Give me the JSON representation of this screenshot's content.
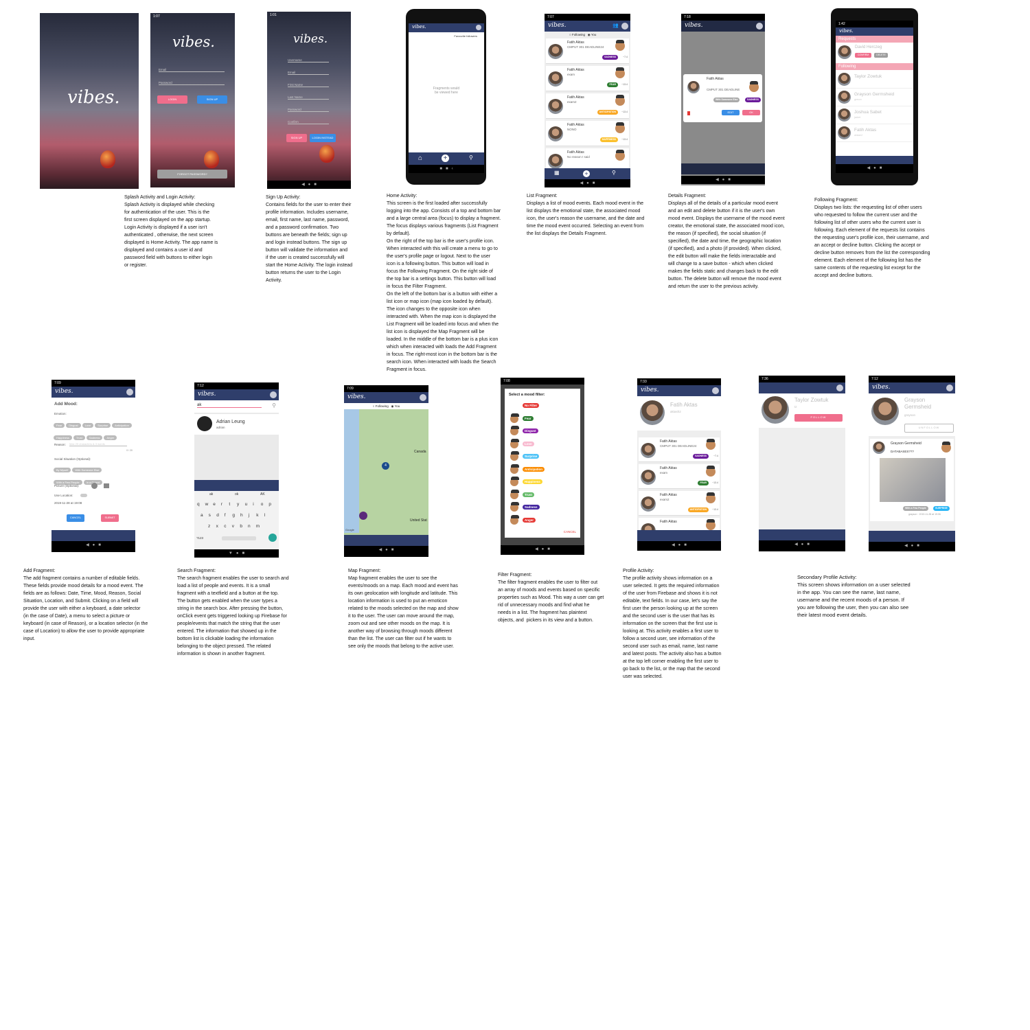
{
  "app": {
    "logo": "vibes."
  },
  "splash": {
    "caption": "Splash Activity and Login Activity:\nSplash Activity is displayed while checking\nfor authentication of the user. This is the\nfirst screen displayed on the app startup.\nLogin Activity is displayed if a user isn't\nauthenticated , otherwise, the next screen\ndisplayed is Home Activity. The app name is\ndisplayed and contains a user id and\npassword field with buttons to either login\nor register."
  },
  "login": {
    "email": "Email",
    "password": "Password",
    "login": "LOGIN",
    "signup": "SIGN UP",
    "forgot": "FORGOT PASSWORD?"
  },
  "signup": {
    "fields": [
      "Username",
      "Email",
      "First Name",
      "Last Name",
      "Password",
      "Confirm"
    ],
    "signup": "SIGN UP",
    "login_instead": "LOGIN INSTEAD",
    "caption": "Sign Up Activity:\nContains fields for the user to enter their\nprofile information. Includes username,\nemail, first name, last name, password,\nand a password confirmation. Two\nbuttons are beneath the fields; sign up\nand login instead buttons. The sign up\nbutton will validate the information and\nif the user is created successfully will\nstart the Home Activity. The login instead\nbutton returns the user to the Login\nActivity."
  },
  "home": {
    "right_link": "Favourite followers",
    "placeholder": "Fragments would\nbe viewed here",
    "caption": "Home Activity:\nThis screen is the first loaded after successfully\nlogging into the app. Consists of a top and bottom bar\nand a large central area (focus) to display a fragment.\nThe focus displays various fragments (List Fragment\nby default).\nOn the right of the top bar is the user's profile icon.\nWhen interacted with this will create a menu to go to\nthe user's profile page or logout. Next to the user\nicon is a following button. This button will load in\nfocus the Following Fragment. On the right side of\nthe top bar is a settings button. This button will load\nin focus the Filter Fragment.\nOn the left of the bottom bar is a button with either a\nlist icon or map icon (map icon loaded by default).\nThe icon changes to the opposite icon when\ninteracted with. When the map icon is displayed the\nList Fragment will be loaded into focus and when the\nlist icon is displayed the Map Fragment will be\nloaded. In the middle of the bottom bar is a plus icon\nwhich when interacted with loads the Add Fragment\nin focus. The right-most icon in the bottom bar is the\nsearch icon. When interacted with loads the Search\nFragment in focus."
  },
  "list": {
    "toggle_following": "Following",
    "toggle_you": "You",
    "items": [
      {
        "name": "Fatih Aktas",
        "reason": "CMPUT 301 DEADLINE24",
        "tag": "SADNESS",
        "tag_color": "#6a1b9a",
        "time": "~7.4"
      },
      {
        "name": "Fatih Aktas",
        "reason": "exam",
        "tag": "FEAR",
        "tag_color": "#2e7d32",
        "time": "~13.4"
      },
      {
        "name": "Fatih Aktas",
        "reason": "exam2",
        "tag": "ANTICIPATION",
        "tag_color": "#f9a825",
        "time": "~13.4"
      },
      {
        "name": "Fatih Aktas",
        "reason": "NONO",
        "tag": "HAPPINESS",
        "tag_color": "#fbc02d",
        "time": "~13.4"
      },
      {
        "name": "Fatih Aktas",
        "reason": "No reason I said",
        "tag": "",
        "tag_color": "#000000",
        "time": ""
      }
    ],
    "caption": "List Fragment:\nDisplays a list of mood events. Each mood event in the\nlist displays the emotional state, the associated mood\nicon, the user's reason the username, and the date and\ntime the mood event occurred. Selecting an event from\nthe list displays the Details Fragment."
  },
  "details": {
    "name": "Fatih Aktas",
    "reason": "CMPUT 301 DEADLINE",
    "situation": "With Someone Else",
    "tag": "SADNESS",
    "edit": "EDIT",
    "ok": "OK",
    "caption": "Details Fragment:\nDisplays all of the details of a particular mood event\nand an edit and delete button if it is the user's own\nmood event. Displays the username of the mood event\ncreator, the emotional state, the associated mood icon,\nthe reason (if specified), the social situation (if\nspecified), the date and time, the geographic location\n(if specified), and a photo (if provided). When clicked,\nthe edit button will make the fields interactable and\nwill change to a save button - which when clicked\nmakes the fields static and changes back to the edit\nbutton. The delete button will remove the mood event\nand return the user to the previous activity."
  },
  "following": {
    "requests_header": "Requests",
    "following_header": "Following",
    "requests": [
      {
        "name": "David Herczeg",
        "accept": "CONFIRM",
        "decline": "DELETE"
      }
    ],
    "list": [
      {
        "name": "Taylor Zowtuk",
        "user": ""
      },
      {
        "name": "Grayson Germsheid",
        "user": "gerson"
      },
      {
        "name": "Joshua Sabet",
        "user": "jsabet"
      },
      {
        "name": "Fatih Aktas",
        "user": "aktash2"
      }
    ],
    "caption": "Following Fragment:\nDisplays two lists: the requesting list of other users\nwho requested to follow the current user and the\nfollowing list of other users who the current user is\nfollowing. Each element of the requests list contains\nthe requesting user's profile icon, their username, and\nan accept or decline button. Clicking the accept or\ndecline button removes from the list the corresponding\nelement. Each element of the following list has the\nsame contents of the requesting list except for the\naccept and decline buttons."
  },
  "add": {
    "title": "Add Mood:",
    "emotion": "Emotion:",
    "emotions": [
      "Fear",
      "Disgust",
      "Love",
      "Surprise",
      "Anticipation",
      "Happiness",
      "Trust",
      "Sadness",
      "Anger"
    ],
    "reason": "Reason:",
    "reason_ph": "Max 20 characters & 3 words",
    "counter": "0 / 20",
    "social": "Social Situation (Optional):",
    "socials": [
      "By Myself",
      "With Someone Else",
      "With a Few People",
      "In a Crowd"
    ],
    "picture": "Picture (Optional):",
    "location": "Use Location:",
    "date": "2019-11-28 at 19:08",
    "cancel": "CANCEL",
    "submit": "SUBMIT",
    "caption": "Add Fragment:\nThe add fragment contains a number of editable fields.\nThese fields provide mood details for a mood event. The\nfields are as follows: Date, Time, Mood, Reason, Social\nSituation, Location, and Submit. Clicking on a field will\nprovide the user with either a keyboard, a date selector\n(in the case of Date), a menu to select a picture or\nkeyboard (in case of Reason), or a location selector (in the\ncase of Location) to allow the user to provide appropriate\ninput."
  },
  "search": {
    "query": "ak",
    "result_name": "Adrian Leung",
    "result_user": "adrian",
    "suggestions": [
      "ak",
      "ok",
      "AK"
    ],
    "keys_row1": [
      "q",
      "w",
      "e",
      "r",
      "t",
      "y",
      "u",
      "i",
      "o",
      "p"
    ],
    "keys_row2": [
      "a",
      "s",
      "d",
      "f",
      "g",
      "h",
      "j",
      "k",
      "l"
    ],
    "keys_row3": [
      "z",
      "x",
      "c",
      "v",
      "b",
      "n",
      "m"
    ],
    "key_num": "?123",
    "caption": "Search Fragment:\nThe search fragment enables the user to search and\nload a list of people and events. It is a small\nfragment with a textfield and a button at the top.\nThe button gets enabled when the user types a\nstring in the search box. After pressing the button,\nonClick event gets triggered looking up Firebase for\npeople/events that match the string that the user\nentered. The information that showed up in the\nbottom list is clickable loading the information\nbelonging to the object pressed. The related\ninformation is shown in another fragment."
  },
  "map": {
    "canada": "Canada",
    "us": "United Stat",
    "cluster": "4",
    "google": "Google",
    "caption": "Map Fragment:\nMap fragment enables the user to see the\nevents/moods on a map. Each mood and event has\nits own geolocation with longitude and latitude. This\nlocation information is used to put an emoticon\nrelated to the moods selected on the map and show\nit to the user. The user can move around the map,\nzoom out and see other moods on the map. It is\nanother way of browsing through moods different\nthan the list. The user can filter out if he wants to\nsee only the moods that belong to the active user."
  },
  "filter": {
    "title": "Select a mood filter:",
    "cancel": "CANCEL",
    "options": [
      {
        "label": "No Filter",
        "color": "#e53935"
      },
      {
        "label": "Fear",
        "color": "#2e7d32"
      },
      {
        "label": "Disgust",
        "color": "#8e24aa"
      },
      {
        "label": "Love",
        "color": "#f8bbd0"
      },
      {
        "label": "Surprise",
        "color": "#4fc3f7"
      },
      {
        "label": "Anticipation",
        "color": "#fb8c00"
      },
      {
        "label": "Happiness",
        "color": "#fdd835"
      },
      {
        "label": "Trust",
        "color": "#66bb6a"
      },
      {
        "label": "Sadness",
        "color": "#4527a0"
      },
      {
        "label": "Anger",
        "color": "#e53935"
      }
    ],
    "caption": "Filter Fragment:\nThe filter fragment enables the user to filter out\nan array of moods and events based on specific\nproperties such as Mood. This way a user can get\nrid of unnecessary moods and find what he\nneeds in a list. The fragment has plaintext\nobjects, and  pickers in its view and a button."
  },
  "profile": {
    "name": "Fatih Aktas",
    "user": "aktash2",
    "items": [
      {
        "name": "Fatih Aktas",
        "reason": "CMPUT 301 DEADLINE24",
        "tag": "SADNESS",
        "tag_color": "#6a1b9a",
        "time": "~7.4"
      },
      {
        "name": "Fatih Aktas",
        "reason": "exam",
        "tag": "FEAR",
        "tag_color": "#2e7d32",
        "time": "~13.4"
      },
      {
        "name": "Fatih Aktas",
        "reason": "exam2",
        "tag": "ANTICIPATION",
        "tag_color": "#f9a825",
        "time": "~13.4"
      },
      {
        "name": "Fatih Aktas",
        "reason": "",
        "tag": "",
        "tag_color": "#000000",
        "time": ""
      }
    ],
    "caption": "Profile Activity:\nThe profile activity shows information on a\nuser selected. It gets the required information\nof the user from Firebase and shows it is not\neditable, text fields. In our case, let's say the\nfirst user the person looking up at the screen\nand the second user is the user that has its\ninformation on the screen that the first use is\nlooking at. This activity enables a first user to\nfollow a second user, see information of the\nsecond user such as email, name, last name\nand latest posts. The activity also has a button\nat the top left corner enabling the first user to\ngo back to the list, or the map that the second\nuser was selected."
  },
  "secondary": {
    "name1": "Taylor Zowtuk",
    "user1": "tz",
    "follow": "FOLLOW",
    "name2": "Grayson\nGermsheid",
    "user2": "grayson",
    "unfollow": "UNFOLLOW",
    "post_name": "Grayson Germsheid",
    "post_text": "DATABASES???",
    "post_situation": "With a Few People",
    "post_tag": "SURPRISE",
    "post_meta": "grayson · 2019-11-28 at 19:06",
    "caption": "Secondary Profile Activity:\nThis screen shows information on a user selected\nin the app. You can see the name, last name,\nusername and the recent moods of a person. If\nyou are following the user, then you can also see\ntheir latest mood event details."
  }
}
